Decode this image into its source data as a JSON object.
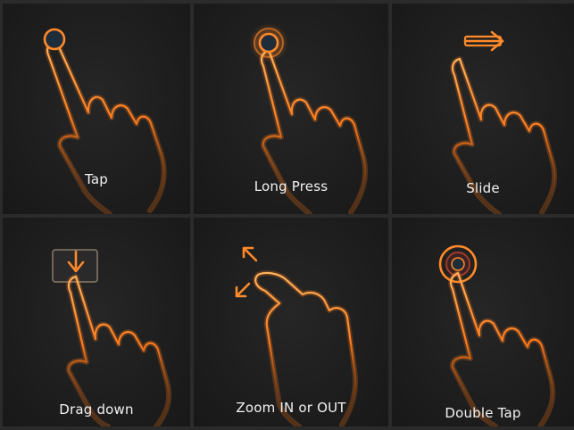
{
  "gestures": [
    {
      "label": "Tap",
      "icon": "tap-icon"
    },
    {
      "label": "Long Press",
      "icon": "long-press-icon"
    },
    {
      "label": "Slide",
      "icon": "slide-icon"
    },
    {
      "label": "Drag down",
      "icon": "drag-down-icon"
    },
    {
      "label": "Zoom IN or OUT",
      "icon": "zoom-icon"
    },
    {
      "label": "Double Tap",
      "icon": "double-tap-icon"
    }
  ],
  "colors": {
    "background": "#1c1c1c",
    "divider": "#2b2b2b",
    "accent": "#ff8a2a",
    "text": "#f2f2f2"
  }
}
